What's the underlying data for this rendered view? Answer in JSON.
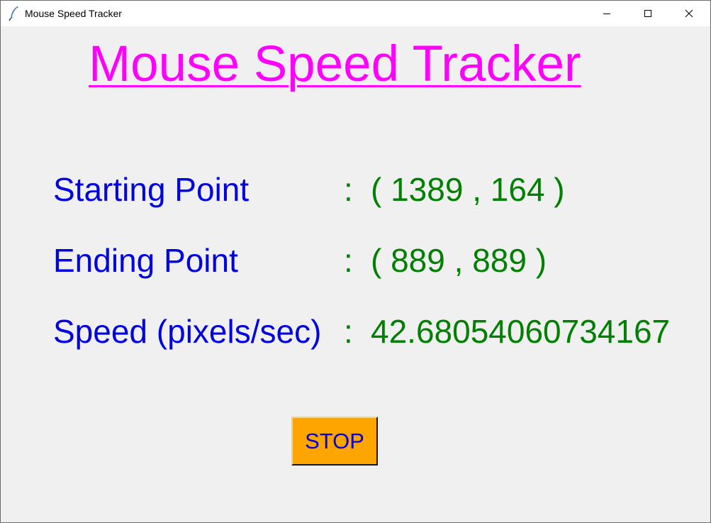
{
  "window": {
    "title": "Mouse Speed Tracker",
    "icon": "feather-icon",
    "controls": [
      "minimize-icon",
      "maximize-icon",
      "close-icon"
    ]
  },
  "heading": "Mouse Speed Tracker",
  "rows": [
    {
      "label": "Starting Point",
      "separator": ":",
      "value": "( 1389 , 164 )"
    },
    {
      "label": "Ending Point",
      "separator": ":",
      "value": "( 889 , 889 )"
    },
    {
      "label": "Speed (pixels/sec)",
      "separator": ":",
      "value": "42.68054060734167"
    }
  ],
  "stop_button": {
    "label": "STOP"
  },
  "colors": {
    "heading": "#ff00ff",
    "label": "#0000e0",
    "value": "#008000",
    "button_bg": "#ffa500",
    "background": "#f0f0f0"
  }
}
